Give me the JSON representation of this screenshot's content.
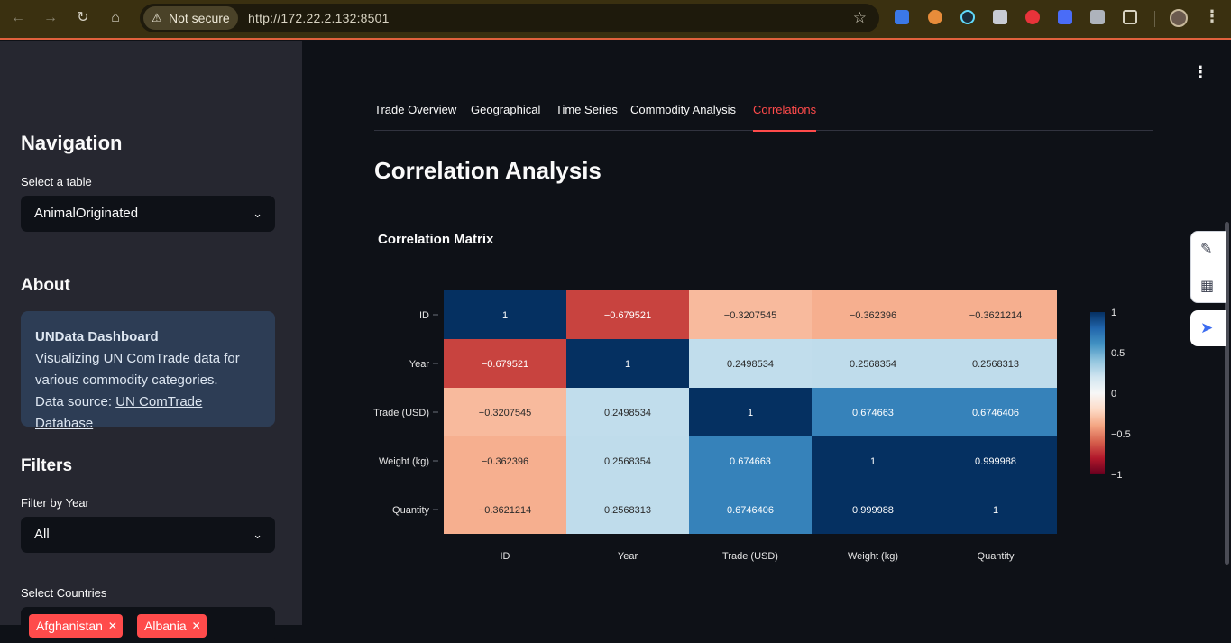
{
  "browser": {
    "security_label": "Not secure",
    "url": "http://172.22.2.132:8501"
  },
  "sidebar": {
    "nav_heading": "Navigation",
    "table_label": "Select a table",
    "table_value": "AnimalOriginated",
    "about_heading": "About",
    "about_title": "UNData Dashboard",
    "about_text": "Visualizing UN ComTrade data for various commodity categories.",
    "about_source_prefix": "Data source:",
    "about_source_link": "UN ComTrade Database",
    "filters_heading": "Filters",
    "year_label": "Filter by Year",
    "year_value": "All",
    "countries_label": "Select Countries",
    "countries": [
      "Afghanistan",
      "Albania"
    ]
  },
  "main": {
    "tabs": [
      "Trade Overview",
      "Geographical",
      "Time Series",
      "Commodity Analysis",
      "Correlations"
    ],
    "active_tab": 4,
    "title": "Correlation Analysis"
  },
  "chart_data": {
    "type": "heatmap",
    "title": "Correlation Matrix",
    "x": [
      "ID",
      "Year",
      "Trade (USD)",
      "Weight (kg)",
      "Quantity"
    ],
    "y": [
      "ID",
      "Year",
      "Trade (USD)",
      "Weight (kg)",
      "Quantity"
    ],
    "z": [
      [
        1,
        -0.679521,
        -0.3207545,
        -0.362396,
        -0.3621214
      ],
      [
        -0.679521,
        1,
        0.2498534,
        0.2568354,
        0.2568313
      ],
      [
        -0.3207545,
        0.2498534,
        1,
        0.674663,
        0.6746406
      ],
      [
        -0.362396,
        0.2568354,
        0.674663,
        1,
        0.999988
      ],
      [
        -0.3621214,
        0.2568313,
        0.6746406,
        0.999988,
        1
      ]
    ],
    "text": [
      [
        "1",
        "−0.679521",
        "−0.3207545",
        "−0.362396",
        "−0.3621214"
      ],
      [
        "−0.679521",
        "1",
        "0.2498534",
        "0.2568354",
        "0.2568313"
      ],
      [
        "−0.3207545",
        "0.2498534",
        "1",
        "0.674663",
        "0.6746406"
      ],
      [
        "−0.362396",
        "0.2568354",
        "0.674663",
        "1",
        "0.999988"
      ],
      [
        "−0.3621214",
        "0.2568313",
        "0.6746406",
        "0.999988",
        "1"
      ]
    ],
    "colorscale": "RdBu",
    "zrange": [
      -1,
      1
    ],
    "colorbar_ticks": [
      1,
      0.5,
      0,
      -0.5,
      -1
    ],
    "colorbar_tick_labels": [
      "1",
      "0.5",
      "0",
      "−0.5",
      "−1"
    ]
  }
}
